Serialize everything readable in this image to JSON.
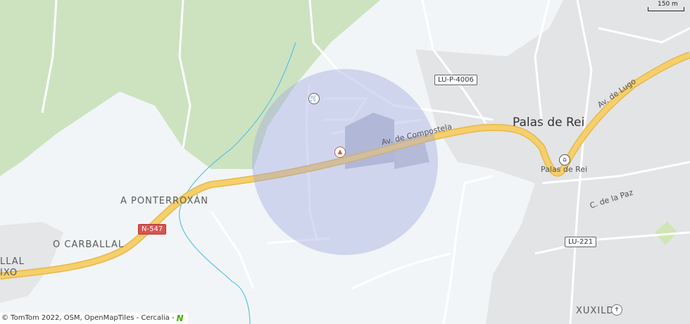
{
  "map": {
    "labels": {
      "palas_de_rei_city": "Palas de Rei",
      "palas_de_rei_poi": "Palas de Rei",
      "a_ponterroxan": "A PONTERROXÁN",
      "o_carballal": "O CARBALLAL",
      "xuxilde": "XUXILDE",
      "partial_town_1": "LLAL",
      "partial_town_2": "IXO"
    },
    "streets": {
      "av_compostela": "Av. de Compostela",
      "av_lugo": "Av. de Lugo",
      "c_paz": "C. de la Paz"
    },
    "roads": {
      "lu_p_4006": "LU-P-4006",
      "n_547": "N-547",
      "lu_221": "LU-221"
    },
    "scale": "150 m",
    "attribution": "© TomTom 2022, OSM, OpenMapTiles - Cercalia -",
    "icons": [
      "shopping-cart-icon",
      "campsite-icon",
      "town-hall-icon",
      "church-icon"
    ],
    "colors": {
      "background": "#f2f5f7",
      "forest": "#cde3c0",
      "urban": "#dfe1e3",
      "main_road": "#f2c85b",
      "highlight_circle": "#9ea6e0",
      "water": "#5bc2e7"
    }
  }
}
